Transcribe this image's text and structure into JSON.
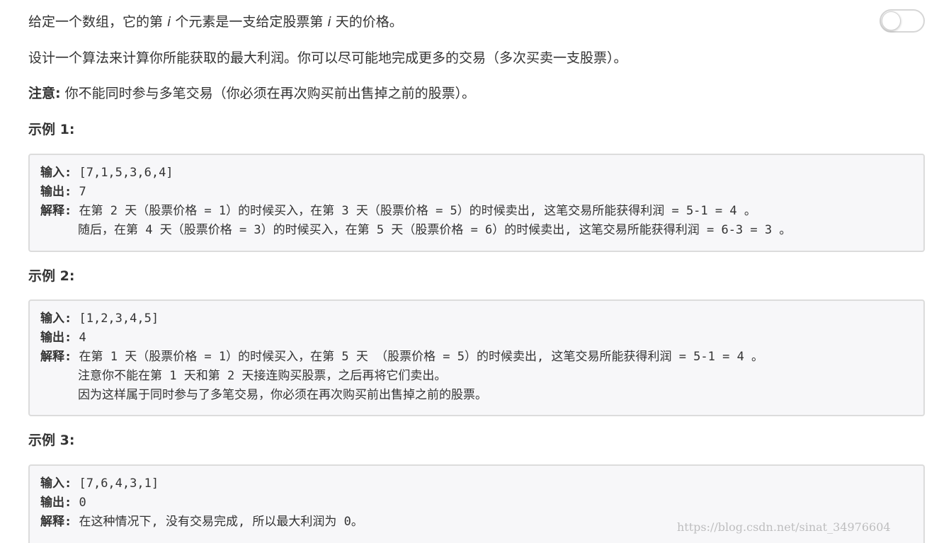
{
  "problem": {
    "line1": {
      "part1": "给定一个数组，它的第 ",
      "var1": "i",
      "part2": " 个元素是一支给定股票第 ",
      "var2": "i",
      "part3": " 天的价格。"
    },
    "line2": "设计一个算法来计算你所能获取的最大利润。你可以尽可能地完成更多的交易（多次买卖一支股票）。",
    "note_label": "注意:",
    "note_text": " 你不能同时参与多笔交易（你必须在再次购买前出售掉之前的股票）。"
  },
  "examples": [
    {
      "heading": "示例 1:",
      "input_label": "输入:",
      "input_value": " [7,1,5,3,6,4]",
      "output_label": "输出:",
      "output_value": " 7",
      "explain_label": "解释:",
      "explain_lines": [
        " 在第 2 天（股票价格 = 1）的时候买入，在第 3 天（股票价格 = 5）的时候卖出, 这笔交易所能获得利润 = 5-1 = 4 。",
        "随后，在第 4 天（股票价格 = 3）的时候买入，在第 5 天（股票价格 = 6）的时候卖出, 这笔交易所能获得利润 = 6-3 = 3 。"
      ]
    },
    {
      "heading": "示例 2:",
      "input_label": "输入:",
      "input_value": " [1,2,3,4,5]",
      "output_label": "输出:",
      "output_value": " 4",
      "explain_label": "解释:",
      "explain_lines": [
        " 在第 1 天（股票价格 = 1）的时候买入，在第 5 天 （股票价格 = 5）的时候卖出, 这笔交易所能获得利润 = 5-1 = 4 。",
        "注意你不能在第 1 天和第 2 天接连购买股票，之后再将它们卖出。",
        "因为这样属于同时参与了多笔交易，你必须在再次购买前出售掉之前的股票。"
      ]
    },
    {
      "heading": "示例 3:",
      "input_label": "输入:",
      "input_value": " [7,6,4,3,1]",
      "output_label": "输出:",
      "output_value": " 0",
      "explain_label": "解释:",
      "explain_lines": [
        " 在这种情况下, 没有交易完成, 所以最大利润为 0。"
      ]
    }
  ],
  "toggle": {
    "state": "off"
  },
  "watermark": "https://blog.csdn.net/sinat_34976604"
}
